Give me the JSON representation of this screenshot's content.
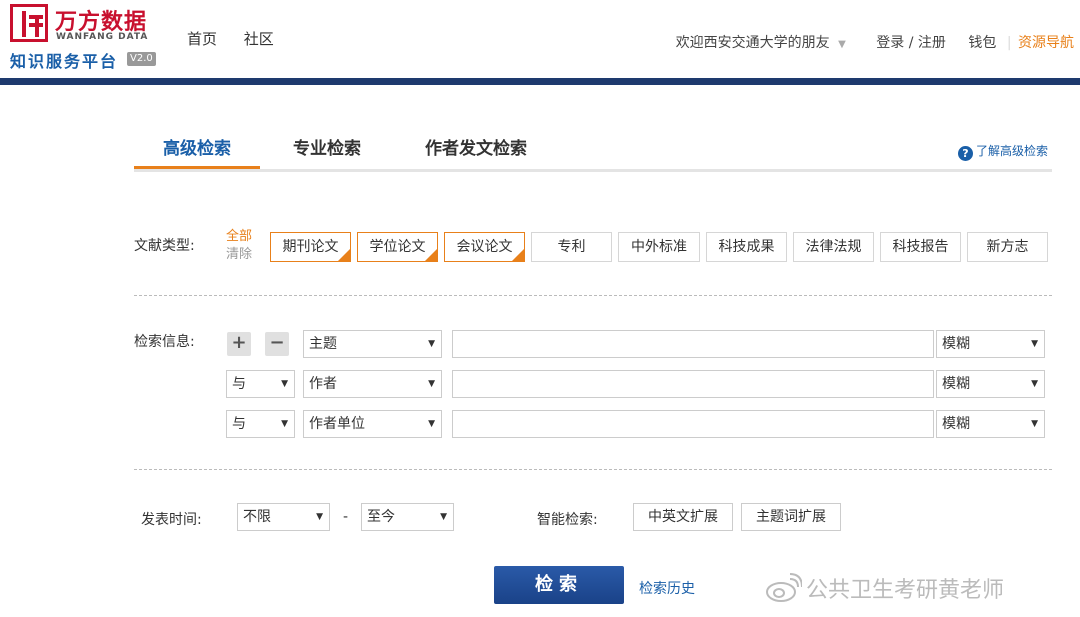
{
  "logo": {
    "cn": "万方数据",
    "en": "WANFANG DATA",
    "sub": "知识服务平台",
    "version": "V2.0"
  },
  "nav": {
    "home": "首页",
    "community": "社区"
  },
  "top_right": {
    "welcome": "欢迎西安交通大学的朋友",
    "login": "登录 / 注册",
    "wallet": "钱包",
    "resource_nav": "资源导航"
  },
  "tabs": [
    {
      "label": "高级检索",
      "active": true
    },
    {
      "label": "专业检索",
      "active": false
    },
    {
      "label": "作者发文检索",
      "active": false
    }
  ],
  "help_link": "了解高级检索",
  "doc_types": {
    "label": "文献类型:",
    "all": "全部",
    "clear": "清除",
    "items": [
      {
        "label": "期刊论文",
        "selected": true
      },
      {
        "label": "学位论文",
        "selected": true
      },
      {
        "label": "会议论文",
        "selected": true
      },
      {
        "label": "专利",
        "selected": false
      },
      {
        "label": "中外标准",
        "selected": false
      },
      {
        "label": "科技成果",
        "selected": false
      },
      {
        "label": "法律法规",
        "selected": false
      },
      {
        "label": "科技报告",
        "selected": false
      },
      {
        "label": "新方志",
        "selected": false
      }
    ]
  },
  "search_info": {
    "label": "检索信息:",
    "add": "+",
    "remove": "−",
    "rows": [
      {
        "logic": "",
        "field": "主题",
        "value": "",
        "match": "模糊"
      },
      {
        "logic": "与",
        "field": "作者",
        "value": "",
        "match": "模糊"
      },
      {
        "logic": "与",
        "field": "作者单位",
        "value": "",
        "match": "模糊"
      }
    ]
  },
  "publish_time": {
    "label": "发表时间:",
    "from": "不限",
    "dash": "-",
    "to": "至今"
  },
  "smart_search": {
    "label": "智能检索:",
    "btn1": "中英文扩展",
    "btn2": "主题词扩展"
  },
  "search_button": "检索",
  "history_link": "检索历史",
  "watermark": "公共卫生考研黄老师",
  "colors": {
    "accent": "#e8801a",
    "brand_blue": "#1a5fa8",
    "header_bar": "#1e3a6e",
    "logo_red": "#c8102e"
  }
}
